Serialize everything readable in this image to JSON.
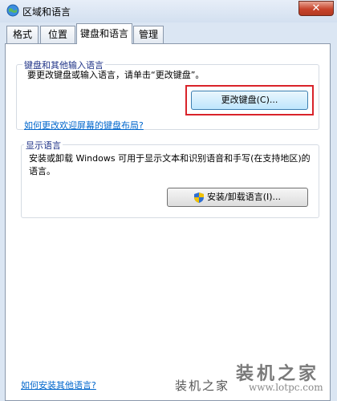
{
  "window": {
    "title": "区域和语言",
    "close_glyph": "✕"
  },
  "tabs": [
    {
      "label": "格式",
      "active": false
    },
    {
      "label": "位置",
      "active": false
    },
    {
      "label": "键盘和语言",
      "active": true
    },
    {
      "label": "管理",
      "active": false
    }
  ],
  "keyboard_section": {
    "legend": "键盘和其他输入语言",
    "description": "要更改键盘或输入语言，请单击“更改键盘”。",
    "change_keyboard_button": "更改键盘(C)...",
    "welcome_layout_link": "如何更改欢迎屏幕的键盘布局?"
  },
  "display_language_section": {
    "legend": "显示语言",
    "description": "安装或卸载 Windows 可用于显示文本和识别语音和手写(在支持地区)的语言。",
    "install_button": "安装/卸载语言(I)..."
  },
  "footer_link": "如何安装其他语言?",
  "watermark": {
    "main": "装机之家",
    "sub": "装机之家",
    "url": "www.lotpc.com"
  },
  "colors": {
    "highlight": "#d9232a",
    "link": "#0066cc",
    "legend": "#1e3287"
  }
}
